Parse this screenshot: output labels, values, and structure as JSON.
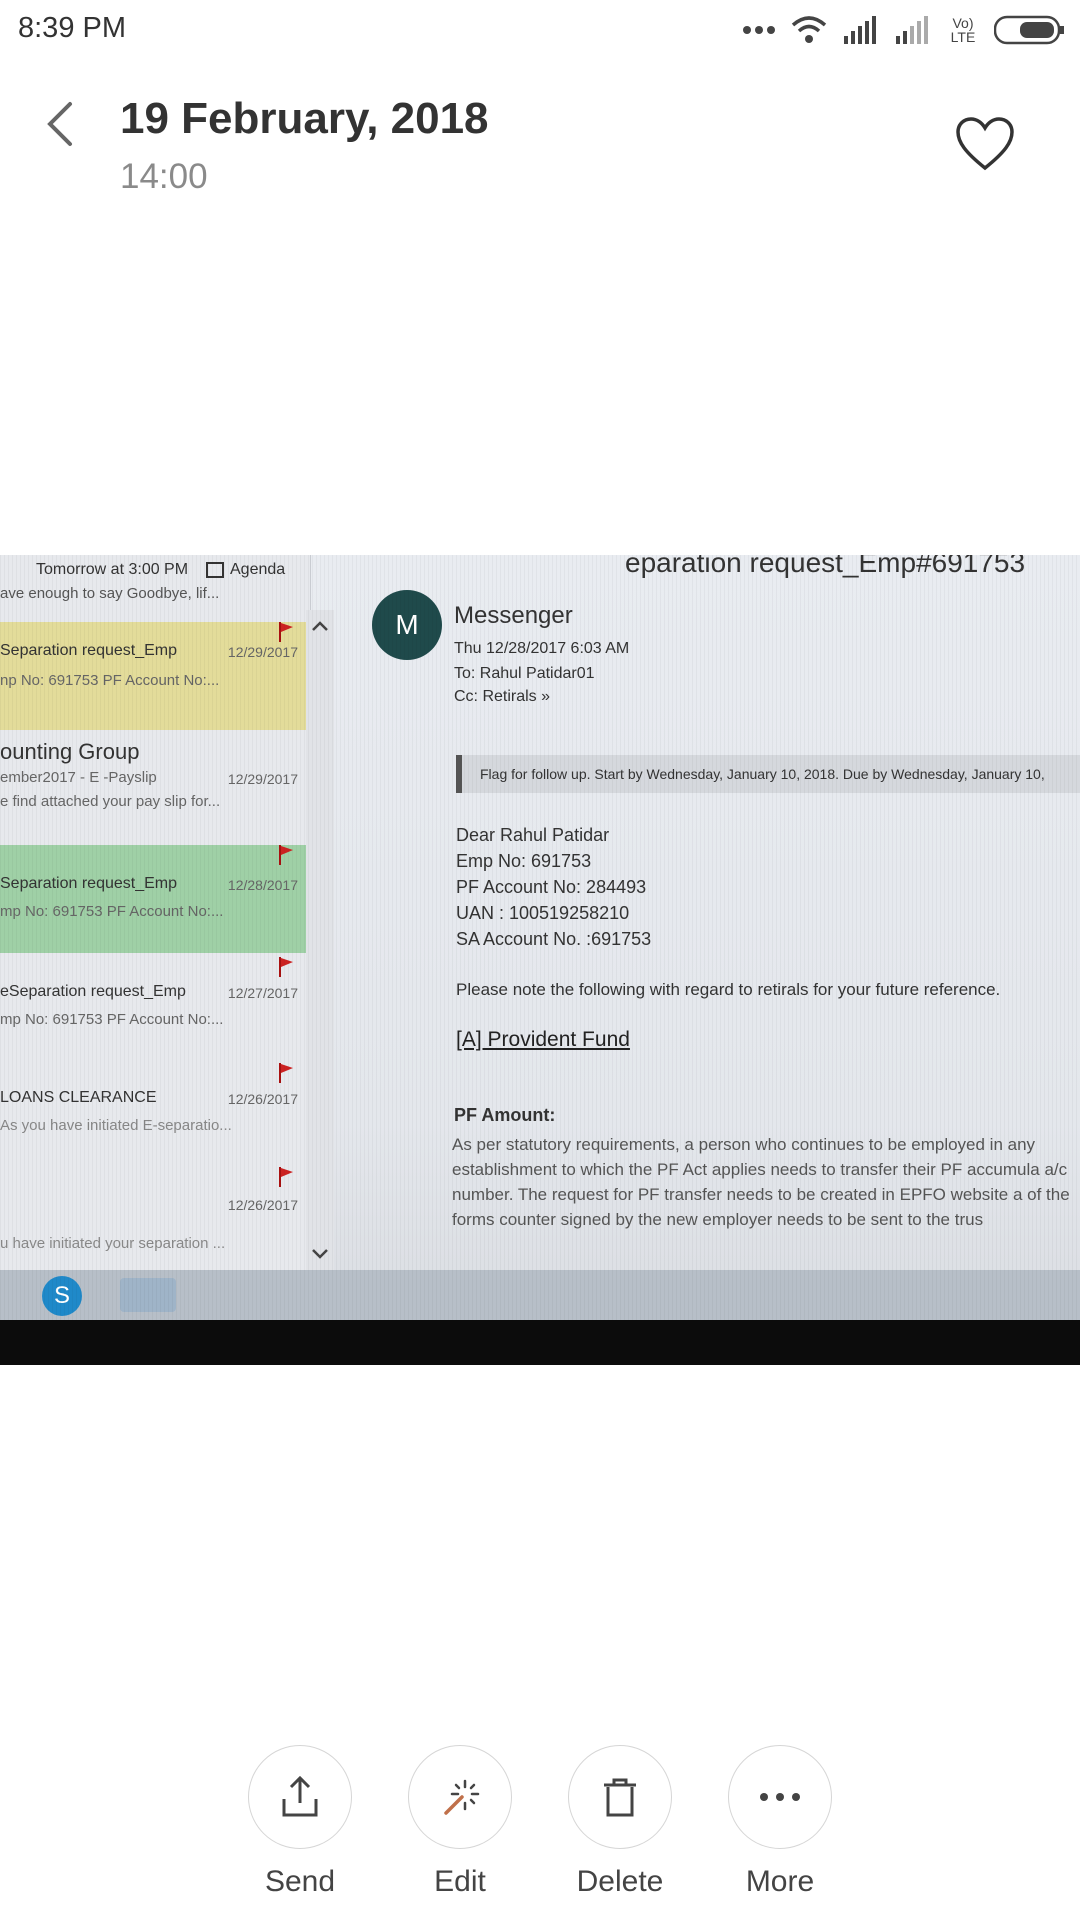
{
  "status_bar": {
    "time": "8:39 PM",
    "network_label": "Vo) LTE"
  },
  "header": {
    "title": "19 February, 2018",
    "subtitle": "14:00"
  },
  "photo": {
    "headline_fragment": "eparation request_Emp#691753",
    "agenda_top": "Tomorrow at 3:00 PM",
    "agenda_label": "Agenda",
    "cut_text": "ave enough to say Goodbye, lif...",
    "mail_list": [
      {
        "title": "Separation request_Emp",
        "date": "12/29/2017",
        "sub": "np No: 691753 PF Account No:..."
      },
      {
        "title": "ounting Group",
        "date": "12/29/2017",
        "sub": "ember2017 - E -Payslip",
        "sub2": "e find attached your pay slip for..."
      },
      {
        "title": "Separation request_Emp",
        "date": "12/28/2017",
        "sub": "mp No: 691753 PF Account No:..."
      },
      {
        "title": "eSeparation request_Emp",
        "date": "12/27/2017",
        "sub": "mp No: 691753 PF Account No:..."
      },
      {
        "title": "LOANS CLEARANCE",
        "date": "12/26/2017",
        "sub": "As you have initiated E-separatio..."
      },
      {
        "title": "",
        "date": "12/26/2017",
        "sub": "u have initiated your separation ..."
      }
    ],
    "email": {
      "avatar_letter": "M",
      "sender": "Messenger",
      "sent": "Thu 12/28/2017 6:03 AM",
      "to": "To:  Rahul Patidar01",
      "cc": "Cc:  Retirals  »",
      "flag_notice": "Flag for follow up. Start by Wednesday, January 10, 2018. Due by Wednesday, January 10,",
      "lines": [
        "Dear Rahul Patidar",
        "Emp No: 691753",
        "PF Account No: 284493",
        "UAN : 100519258210",
        "SA Account No. :691753"
      ],
      "note": "Please note the following with regard to retirals for your future reference.",
      "section": "[A] Provident Fund",
      "pf_amount_label": "PF Amount:",
      "paragraph": "As per statutory requirements, a person who continues to be employed in any establishment to which the PF Act applies needs to transfer their PF accumula a/c number. The request for PF transfer needs to be created in EPFO website a of the forms counter signed by the new employer needs to be sent to the trus"
    },
    "taskbar_skype": "S"
  },
  "actions": [
    {
      "label": "Send",
      "icon": "share-icon"
    },
    {
      "label": "Edit",
      "icon": "magic-wand-icon"
    },
    {
      "label": "Delete",
      "icon": "trash-icon"
    },
    {
      "label": "More",
      "icon": "more-dots-icon"
    }
  ]
}
